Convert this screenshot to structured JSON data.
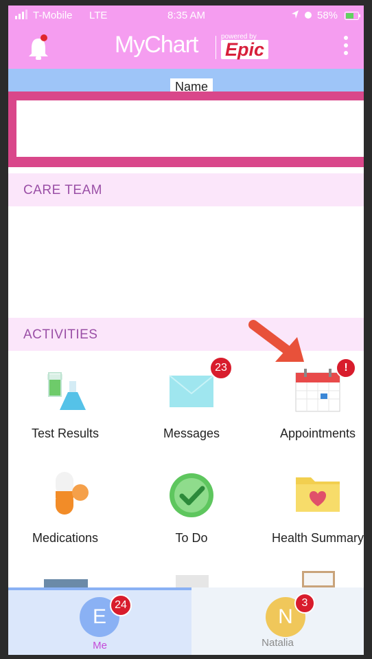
{
  "status_bar": {
    "carrier": "T-Mobile",
    "network": "LTE",
    "time": "8:35 AM",
    "battery": "58%"
  },
  "header": {
    "logo_text": "MyChart",
    "powered_by": "powered by",
    "brand": "Epic"
  },
  "name_bar": {
    "label": "Name"
  },
  "care_team": {
    "title": "CARE TEAM"
  },
  "activities": {
    "title": "ACTIVITIES",
    "tiles": [
      {
        "label": "Test Results",
        "icon": "test-tubes-icon"
      },
      {
        "label": "Messages",
        "icon": "envelope-icon",
        "badge": "23"
      },
      {
        "label": "Appointments",
        "icon": "calendar-icon",
        "badge": "!"
      },
      {
        "label": "Medications",
        "icon": "pill-icon"
      },
      {
        "label": "To Do",
        "icon": "checkmark-icon"
      },
      {
        "label": "Health Summary",
        "icon": "folder-heart-icon"
      }
    ]
  },
  "tabs": [
    {
      "initial": "E",
      "label": "Me",
      "badge": "24",
      "color": "#8ab1f4"
    },
    {
      "initial": "N",
      "label": "Natalia",
      "badge": "3",
      "color": "#f0c75a"
    }
  ],
  "colors": {
    "header": "#f59df0",
    "accent_pink": "#d9478a",
    "name_bar": "#9ec5f8",
    "badge": "#d81c2c",
    "arrow": "#e8513a"
  }
}
